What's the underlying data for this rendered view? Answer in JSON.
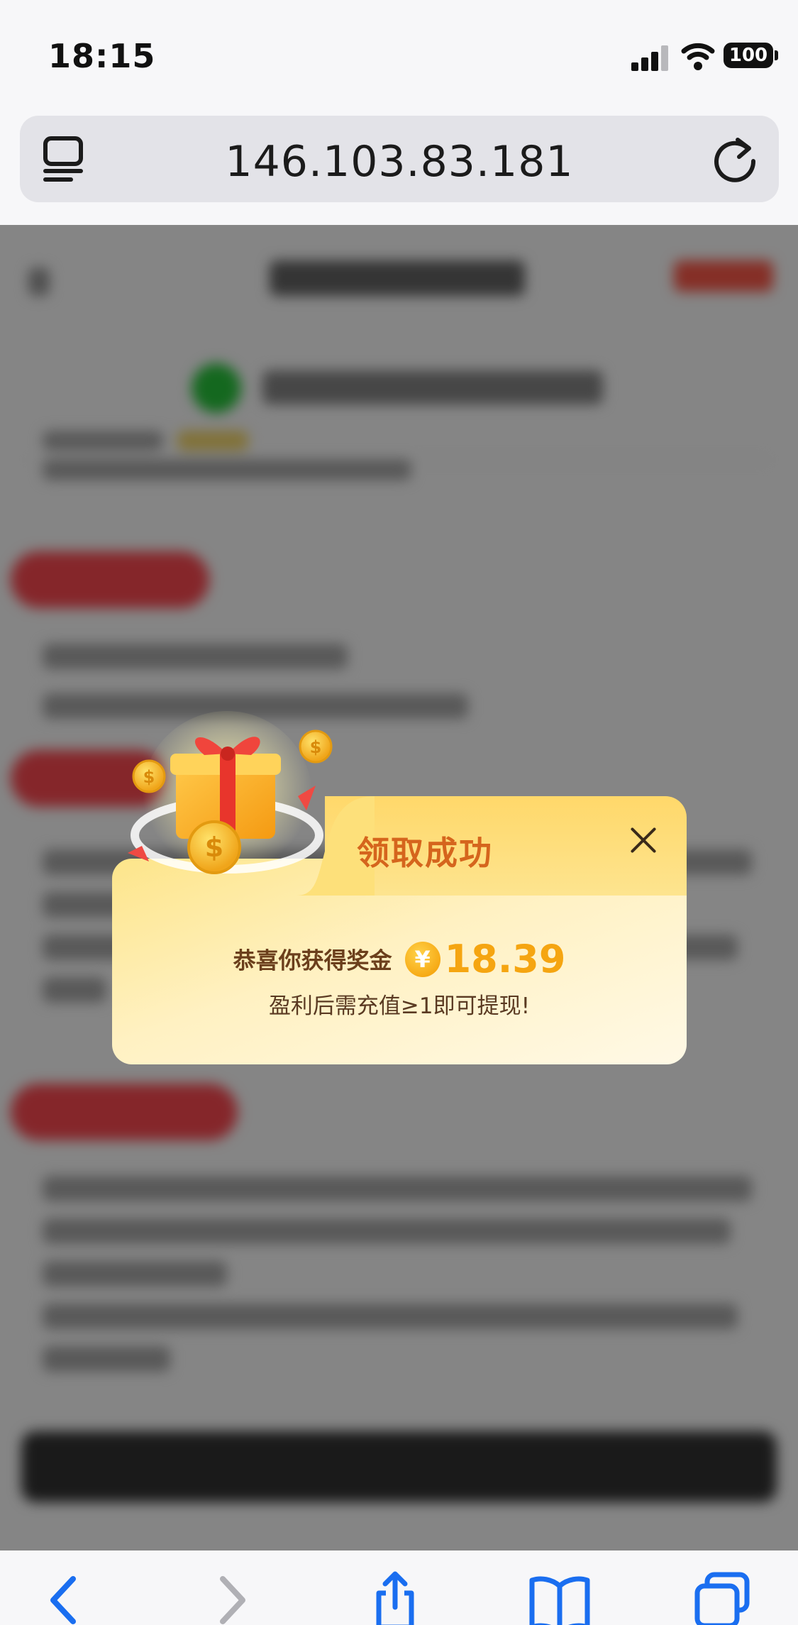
{
  "status_bar": {
    "time": "18:15",
    "battery": "100"
  },
  "browser": {
    "url": "146.103.83.181"
  },
  "dialog": {
    "title": "领取成功",
    "congrats_label": "恭喜你获得奖金",
    "currency_symbol": "¥",
    "amount": "18.39",
    "note": "盈利后需充值≥1即可提现!"
  },
  "colors": {
    "title": "#d5651d",
    "amount": "#f5a511",
    "link_blue": "#1a6ef0",
    "overlay": "rgba(0,0,0,0.48)"
  },
  "toolbar": {
    "icons": [
      "back-chevron-icon",
      "forward-chevron-icon",
      "share-icon",
      "bookmarks-icon",
      "tabs-icon"
    ]
  }
}
